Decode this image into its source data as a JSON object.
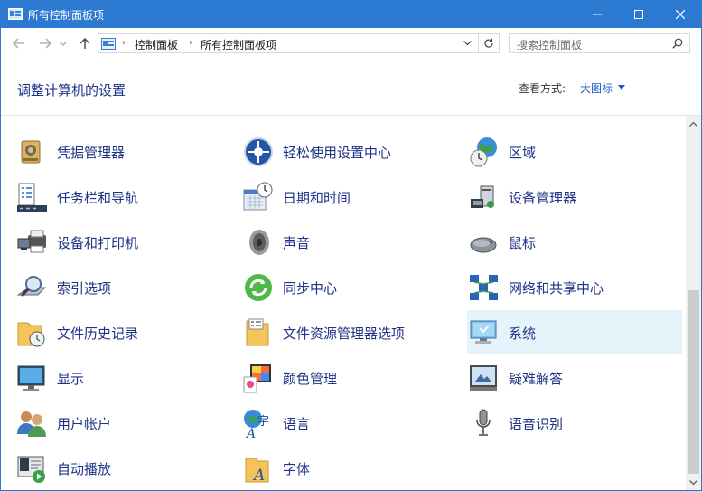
{
  "window": {
    "title": "所有控制面板项"
  },
  "address": {
    "crumbs": [
      "控制面板",
      "所有控制面板项"
    ]
  },
  "search": {
    "placeholder": "搜索控制面板"
  },
  "header": {
    "title": "调整计算机的设置",
    "view_by_label": "查看方式:",
    "view_by_value": "大图标"
  },
  "items": [
    {
      "label": "凭据管理器",
      "icon": "credential-manager-icon"
    },
    {
      "label": "轻松使用设置中心",
      "icon": "ease-of-access-icon"
    },
    {
      "label": "区域",
      "icon": "region-icon"
    },
    {
      "label": "任务栏和导航",
      "icon": "taskbar-icon"
    },
    {
      "label": "日期和时间",
      "icon": "date-time-icon"
    },
    {
      "label": "设备管理器",
      "icon": "device-manager-icon"
    },
    {
      "label": "设备和打印机",
      "icon": "devices-printers-icon"
    },
    {
      "label": "声音",
      "icon": "sound-icon"
    },
    {
      "label": "鼠标",
      "icon": "mouse-icon"
    },
    {
      "label": "索引选项",
      "icon": "indexing-options-icon"
    },
    {
      "label": "同步中心",
      "icon": "sync-center-icon"
    },
    {
      "label": "网络和共享中心",
      "icon": "network-sharing-icon"
    },
    {
      "label": "文件历史记录",
      "icon": "file-history-icon"
    },
    {
      "label": "文件资源管理器选项",
      "icon": "file-explorer-options-icon"
    },
    {
      "label": "系统",
      "icon": "system-icon"
    },
    {
      "label": "显示",
      "icon": "display-icon"
    },
    {
      "label": "颜色管理",
      "icon": "color-management-icon"
    },
    {
      "label": "疑难解答",
      "icon": "troubleshooting-icon"
    },
    {
      "label": "用户帐户",
      "icon": "user-accounts-icon"
    },
    {
      "label": "语言",
      "icon": "language-icon"
    },
    {
      "label": "语音识别",
      "icon": "speech-recognition-icon"
    },
    {
      "label": "自动播放",
      "icon": "autoplay-icon"
    },
    {
      "label": "字体",
      "icon": "fonts-icon"
    }
  ],
  "colors": {
    "accent": "#2b79d0",
    "link": "#1e3287",
    "selected_bg": "#e5f3fb"
  }
}
